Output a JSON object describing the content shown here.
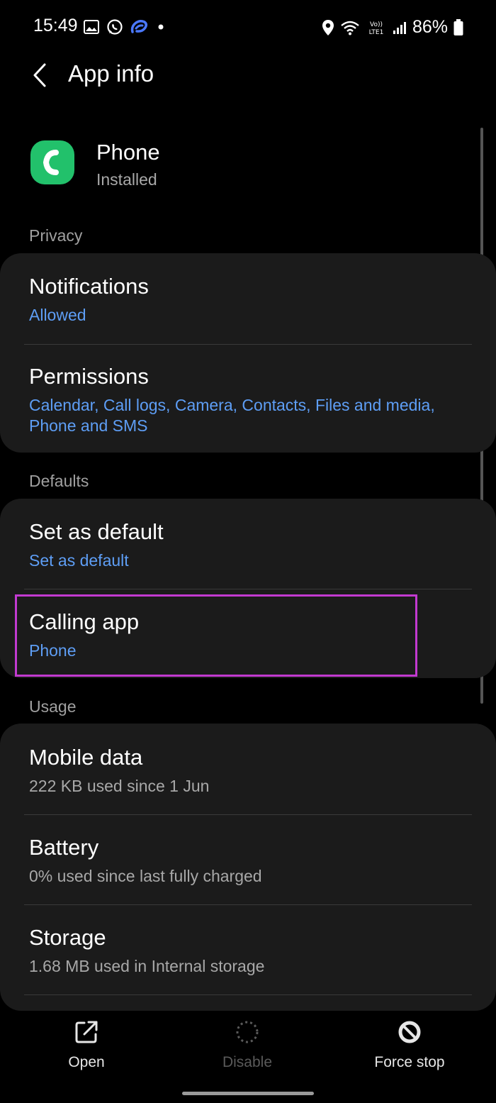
{
  "status_bar": {
    "time": "15:49",
    "battery": "86%",
    "icons_left": [
      "gallery-icon",
      "whatsapp-icon",
      "app-notification-icon",
      "dot-icon"
    ],
    "icons_right": [
      "location-icon",
      "wifi-icon",
      "volte-lte-icon",
      "signal-icon",
      "battery-icon"
    ],
    "volte_text": "Vo)) LTE1"
  },
  "header": {
    "title": "App info",
    "back_icon": "chevron-left-icon"
  },
  "app": {
    "name": "Phone",
    "status": "Installed",
    "icon": "phone-app-icon",
    "icon_color": "#22c16b"
  },
  "sections": {
    "privacy": "Privacy",
    "defaults": "Defaults",
    "usage": "Usage"
  },
  "rows": {
    "notifications": {
      "title": "Notifications",
      "subtitle": "Allowed"
    },
    "permissions": {
      "title": "Permissions",
      "subtitle": "Calendar, Call logs, Camera, Contacts, Files and media, Phone and SMS"
    },
    "set_default": {
      "title": "Set as default",
      "subtitle": "Set as default"
    },
    "calling_app": {
      "title": "Calling app",
      "subtitle": "Phone"
    },
    "mobile_data": {
      "title": "Mobile data",
      "subtitle": "222 KB used since 1 Jun"
    },
    "battery": {
      "title": "Battery",
      "subtitle": "0% used since last fully charged"
    },
    "storage": {
      "title": "Storage",
      "subtitle": "1.68 MB used in Internal storage"
    }
  },
  "bottom_bar": {
    "open": "Open",
    "disable": "Disable",
    "force_stop": "Force stop"
  },
  "colors": {
    "accent_blue": "#5e9ef5",
    "highlight": "#c23ad0",
    "card": "#1b1b1b",
    "background": "#000000"
  }
}
